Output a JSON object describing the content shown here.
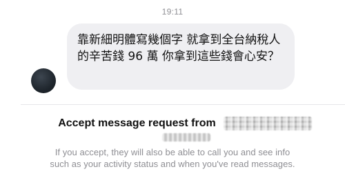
{
  "thread": {
    "timestamp": "19:11",
    "message": {
      "text": "靠新細明體寫幾個字 就拿到全台納稅人的辛苦錢 96 萬 你拿到這些錢會心安？"
    }
  },
  "message_request": {
    "title": "Accept message request from",
    "info_line_1": "If you accept, they will also be able to call you and see info",
    "info_line_2": "such as your activity status and when you've read messages."
  }
}
